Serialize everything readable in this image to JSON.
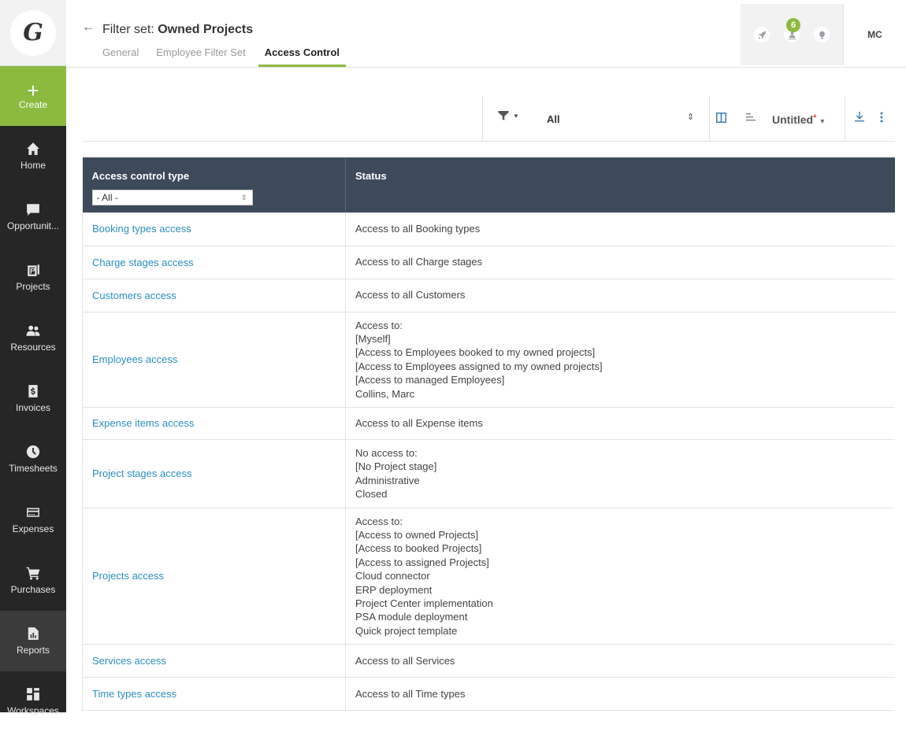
{
  "app": {
    "logo_letter": "G"
  },
  "sidebar": {
    "create_label": "Create",
    "items": [
      {
        "label": "Home",
        "icon": "home-icon"
      },
      {
        "label": "Opportunit...",
        "icon": "chat-icon"
      },
      {
        "label": "Projects",
        "icon": "projects-icon"
      },
      {
        "label": "Resources",
        "icon": "people-icon"
      },
      {
        "label": "Invoices",
        "icon": "invoice-icon"
      },
      {
        "label": "Timesheets",
        "icon": "clock-icon"
      },
      {
        "label": "Expenses",
        "icon": "card-icon"
      },
      {
        "label": "Purchases",
        "icon": "cart-icon"
      },
      {
        "label": "Reports",
        "icon": "report-icon"
      },
      {
        "label": "Workspaces",
        "icon": "grid-icon"
      }
    ]
  },
  "header": {
    "title_prefix": "Filter set: ",
    "title_bold": "Owned Projects",
    "tabs": [
      {
        "label": "General"
      },
      {
        "label": "Employee Filter Set"
      },
      {
        "label": "Access Control"
      }
    ],
    "notification_count": "6",
    "avatar_initials": "MC"
  },
  "toolbar": {
    "filter_value": "All",
    "view_name": "Untitled",
    "view_modified_marker": "*"
  },
  "table": {
    "columns": [
      "Access control type",
      "Status"
    ],
    "type_filter_value": "- All -",
    "rows": [
      {
        "type": "Booking types access",
        "status": "Access to all Booking types"
      },
      {
        "type": "Charge stages access",
        "status": "Access to all Charge stages"
      },
      {
        "type": "Customers access",
        "status": "Access to all Customers"
      },
      {
        "type": "Employees access",
        "status": "Access to:\n[Myself]\n[Access to Employees booked to my owned projects]\n[Access to Employees assigned to my owned projects]\n[Access to managed Employees]\nCollins, Marc"
      },
      {
        "type": "Expense items access",
        "status": "Access to all Expense items"
      },
      {
        "type": "Project stages access",
        "status": "No access to:\n[No Project stage]\nAdministrative\nClosed"
      },
      {
        "type": "Projects access",
        "status": "Access to:\n[Access to owned Projects]\n[Access to booked Projects]\n[Access to assigned Projects]\nCloud connector\nERP deployment\nProject Center implementation\nPSA module deployment\nQuick project template"
      },
      {
        "type": "Services access",
        "status": "Access to all Services"
      },
      {
        "type": "Time types access",
        "status": "Access to all Time types"
      }
    ]
  },
  "colors": {
    "accent_green": "#8cba3f",
    "sidebar_bg": "#262626",
    "table_header_bg": "#3d4a5c",
    "link_blue": "#2a8fbd"
  }
}
